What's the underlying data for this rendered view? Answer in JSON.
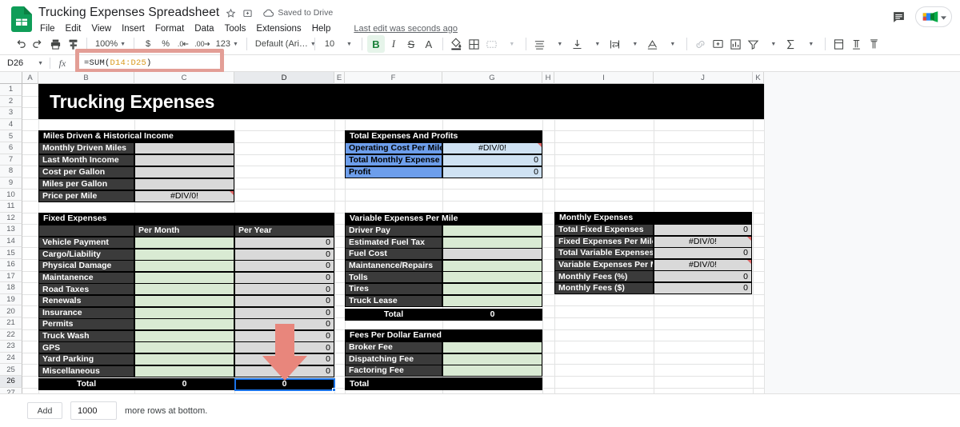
{
  "app": {
    "logo_icon": "google-sheets-icon",
    "doc_title": "Trucking Expenses Spreadsheet",
    "star_icon": "star-icon",
    "move_icon": "move-to-folder-icon",
    "cloud_icon": "cloud-saved-icon",
    "saved_status": "Saved to Drive",
    "last_edit": "Last edit was seconds ago",
    "comment_icon": "comment-history-icon",
    "meet_icon": "google-meet-icon",
    "meet_caret": "chevron-down-icon"
  },
  "menu": [
    "File",
    "Edit",
    "View",
    "Insert",
    "Format",
    "Data",
    "Tools",
    "Extensions",
    "Help"
  ],
  "toolbar": {
    "undo": "undo-icon",
    "redo": "redo-icon",
    "print": "print-icon",
    "paint": "paint-format-icon",
    "zoom_value": "100%",
    "currency": "$",
    "percent": "%",
    "dec_decrease": ".0",
    "dec_increase": ".00",
    "more_formats": "123",
    "font_family": "Default (Ari…",
    "font_size": "10",
    "bold": "B",
    "italic": "I",
    "strikethrough": "S",
    "text_color": "A",
    "fill_color": "fill-color-icon",
    "borders": "borders-icon",
    "merge": "merge-cells-icon",
    "h_align": "horizontal-align-icon",
    "v_align": "vertical-align-icon",
    "wrap": "text-wrap-icon",
    "rotate": "text-rotation-icon",
    "link": "insert-link-icon",
    "comment": "insert-comment-icon",
    "chart": "insert-chart-icon",
    "filter": "filter-icon",
    "functions": "functions-icon",
    "freeze": "freeze-icon",
    "lines1": "paragraph-icon",
    "lines2": "paragraph-alt-icon"
  },
  "formula_bar": {
    "name_box": "D26",
    "fx_label": "fx",
    "formula_prefix": "=SUM(",
    "formula_range": "D14:D25",
    "formula_suffix": ")"
  },
  "grid": {
    "columns": [
      "A",
      "B",
      "C",
      "D",
      "E",
      "F",
      "G",
      "H",
      "I",
      "J",
      "K"
    ],
    "active_column": "D",
    "rows": [
      1,
      2,
      3,
      4,
      5,
      6,
      7,
      8,
      9,
      10,
      11,
      12,
      13,
      14,
      15,
      16,
      17,
      18,
      19,
      20,
      21,
      22,
      23,
      24,
      25,
      26,
      27
    ],
    "active_row": 26,
    "selected_cell": "D26"
  },
  "sheet": {
    "banner_title": "Trucking Expenses",
    "tables": {
      "miles_driven": {
        "header": "Miles Driven & Historical Income",
        "rows": [
          {
            "label": "Monthly Driven Miles",
            "value": ""
          },
          {
            "label": "Last Month Income",
            "value": ""
          },
          {
            "label": "Cost per Gallon",
            "value": ""
          },
          {
            "label": "Miles per Gallon",
            "value": ""
          },
          {
            "label": "Price per Mile",
            "value": "#DIV/0!"
          }
        ]
      },
      "total_expenses_profits": {
        "header": "Total Expenses And Profits",
        "rows": [
          {
            "label": "Operating Cost Per Mile",
            "value": "#DIV/0!",
            "align": "center"
          },
          {
            "label": "Total Monthly Expense",
            "value": "0",
            "align": "right"
          },
          {
            "label": "Profit",
            "value": "0",
            "align": "right"
          }
        ]
      },
      "fixed_expenses": {
        "header": "Fixed Expenses",
        "col_headers": [
          "",
          "Per Month",
          "Per Year"
        ],
        "rows": [
          {
            "label": "Vehicle Payment",
            "per_month": "",
            "per_year": "0"
          },
          {
            "label": "Cargo/Liability",
            "per_month": "",
            "per_year": "0"
          },
          {
            "label": "Physical Damage",
            "per_month": "",
            "per_year": "0"
          },
          {
            "label": "Maintanence",
            "per_month": "",
            "per_year": "0"
          },
          {
            "label": "Road Taxes",
            "per_month": "",
            "per_year": "0"
          },
          {
            "label": "Renewals",
            "per_month": "",
            "per_year": "0"
          },
          {
            "label": "Insurance",
            "per_month": "",
            "per_year": "0"
          },
          {
            "label": "Permits",
            "per_month": "",
            "per_year": "0"
          },
          {
            "label": "Truck Wash",
            "per_month": "",
            "per_year": "0"
          },
          {
            "label": "GPS",
            "per_month": "",
            "per_year": "0"
          },
          {
            "label": "Yard Parking",
            "per_month": "",
            "per_year": "0"
          },
          {
            "label": "Miscellaneous",
            "per_month": "",
            "per_year": "0"
          }
        ],
        "total_label": "Total",
        "total_per_month": "0",
        "total_per_year": "0"
      },
      "variable_expenses": {
        "header": "Variable Expenses Per Mile",
        "rows": [
          {
            "label": "Driver Pay",
            "value": "",
            "style": "green"
          },
          {
            "label": "Estimated Fuel Tax",
            "value": "",
            "style": "green"
          },
          {
            "label": "Fuel Cost",
            "value": "",
            "style": "gray"
          },
          {
            "label": "Maintanence/Repairs",
            "value": "",
            "style": "green"
          },
          {
            "label": "Tolls",
            "value": "",
            "style": "green"
          },
          {
            "label": "Tires",
            "value": "",
            "style": "green"
          },
          {
            "label": "Truck Lease",
            "value": "",
            "style": "green"
          }
        ],
        "total_label": "Total",
        "total_value": "0"
      },
      "fees_per_dollar": {
        "header": "Fees Per Dollar Earned",
        "rows": [
          {
            "label": "Broker Fee",
            "value": ""
          },
          {
            "label": "Dispatching Fee",
            "value": ""
          },
          {
            "label": "Factoring Fee",
            "value": ""
          }
        ],
        "total_label": "Total",
        "total_value": ""
      },
      "monthly_expenses": {
        "header": "Monthly Expenses",
        "rows": [
          {
            "label": "Total Fixed Expenses",
            "value": "0",
            "align": "right"
          },
          {
            "label": "Fixed Expenses Per Mile",
            "value": "#DIV/0!",
            "align": "center"
          },
          {
            "label": "Total Variable Expenses",
            "value": "0",
            "align": "right"
          },
          {
            "label": "Variable Expenses Per Mile",
            "value": "#DIV/0!",
            "align": "center"
          },
          {
            "label": "Monthly Fees (%)",
            "value": "0",
            "align": "right"
          },
          {
            "label": "Monthly Fees ($)",
            "value": "0",
            "align": "right"
          }
        ]
      }
    }
  },
  "footer": {
    "add_label": "Add",
    "rows_count": "1000",
    "suffix": "more rows at bottom."
  },
  "colors": {
    "header_black": "#000000",
    "label_dark": "#3b3b3b",
    "label_blue": "#6d9eeb",
    "value_blue": "#cfe2f3",
    "value_green": "#d9ead3",
    "value_gray": "#d9d9d9",
    "selection": "#1a73e8",
    "highlight_box": "#e39e96",
    "arrow": "#e8867c"
  }
}
